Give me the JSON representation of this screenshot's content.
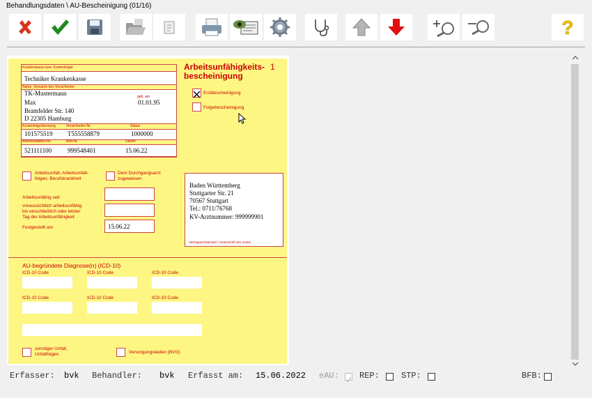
{
  "window": {
    "title": "Behandlungsdaten \\ AU-Bescheinigung (01/16)"
  },
  "toolbar": {
    "buttons": [
      "cancel",
      "confirm",
      "save",
      "open-folder",
      "document",
      "print",
      "view",
      "settings",
      "stethoscope",
      "up",
      "down",
      "zoom-in",
      "zoom-out",
      "help"
    ],
    "colors": {
      "cancel": "#d9331a",
      "confirm": "#1e8a1e",
      "down": "#e01010",
      "help": "#f2c200"
    }
  },
  "form": {
    "number": "1",
    "title_line1": "Arbeitsunfähigkeits-",
    "title_line2": "bescheinigung",
    "insurer_label": "Krankenkasse bzw. Kostenträger",
    "insurer": "Techniker Krankenkasse",
    "name_label": "Name, Vorname des Versicherten",
    "last_name": "TK-Mustermann",
    "first_name": "Max",
    "dob_label": "geb. am",
    "dob": "01.01.95",
    "street": "Bramfelder Str. 140",
    "city": "D 22305 Hamburg",
    "kassen_label": "Kostenträgerkennung",
    "kassen_nr": "101575519",
    "versicherten_label": "Versicherten-Nr.",
    "versicherten_nr": "T555558879",
    "status_label": "Status",
    "status": "1000000",
    "betriebs_label": "Betriebsstätten-Nr.",
    "betriebs_nr": "521111100",
    "arzt_label": "Arzt-Nr.",
    "arzt_nr": "999548401",
    "datum_label": "Datum",
    "datum": "15.06.22",
    "erst_label": "Erstbescheinigung",
    "erst_checked": true,
    "folge_label": "Folgebescheinigung",
    "folge_checked": false,
    "arbeitsunfall_label_1": "Arbeitsunfall, Arbeitsunfall-",
    "arbeitsunfall_label_2": "folgen, Berufskrankheit",
    "durchgangsarzt_label_1": "Dem Durchgangsarzt",
    "durchgangsarzt_label_2": "zugewiesen",
    "au_seit_label": "Arbeitsunfähig seit",
    "au_bis_label_1": "voraussichtlich arbeitsunfähig",
    "au_bis_label_2": "bis einschließlich oder letzter",
    "au_bis_label_3": "Tag der Arbeitsunfähigkeit",
    "festgestellt_label": "Festgestellt am",
    "festgestellt": "15.06.22",
    "doctor_line1": "Baden Württemberg",
    "doctor_line2": "Stuttgarter Str. 21",
    "doctor_line3": "70567 Stuttgart",
    "doctor_line4": "Tel.: 0711/76768",
    "doctor_line5": "KV-Arztnummer: 999999901",
    "stamp_label": "Vertragsarztstempel / Unterschrift des Arztes",
    "diagnose_title": "AU-begründete Diagnose(n) (ICD-10)",
    "icd_label": "ICD-10 Code",
    "sonstiger_label_1": "sonstiger Unfall,",
    "sonstiger_label_2": "Unfallfolgen",
    "versorgung_label": "Versorgungsleiden (BVG)"
  },
  "status": {
    "erfasser_label": "Erfasser:",
    "erfasser": "bvk",
    "behandler_label": "Behandler:",
    "behandler": "bvk",
    "erfasst_label": "Erfasst am:",
    "erfasst": "15.06.2022",
    "eau_label": "eAU:",
    "rep_label": "REP:",
    "stp_label": "STP:",
    "bfb_label": "BFB:"
  }
}
